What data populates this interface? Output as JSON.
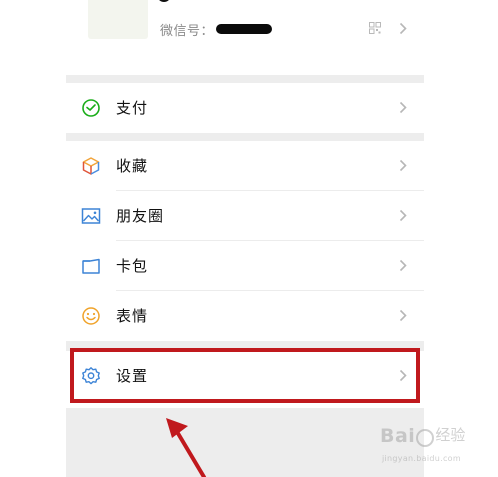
{
  "profile": {
    "wechat_id_label": "微信号："
  },
  "menu": [
    {
      "label": "支付"
    },
    {
      "label": "收藏"
    },
    {
      "label": "朋友圈"
    },
    {
      "label": "卡包"
    },
    {
      "label": "表情"
    },
    {
      "label": "设置"
    }
  ],
  "colors": {
    "highlight_border": "#c0191d",
    "pay_icon": "#1aad19",
    "fav_icon_top": "#f2a43a",
    "fav_icon_side": "#4a8de0",
    "moments_icon": "#3d84d6",
    "cards_icon": "#3d84d6",
    "stickers_icon": "#f0a32a",
    "settings_icon": "#3d84d6",
    "group_gap": "#ededed"
  },
  "watermark": {
    "brand": "Bai",
    "cn": "经验",
    "url": "jingyan.baidu.com"
  }
}
